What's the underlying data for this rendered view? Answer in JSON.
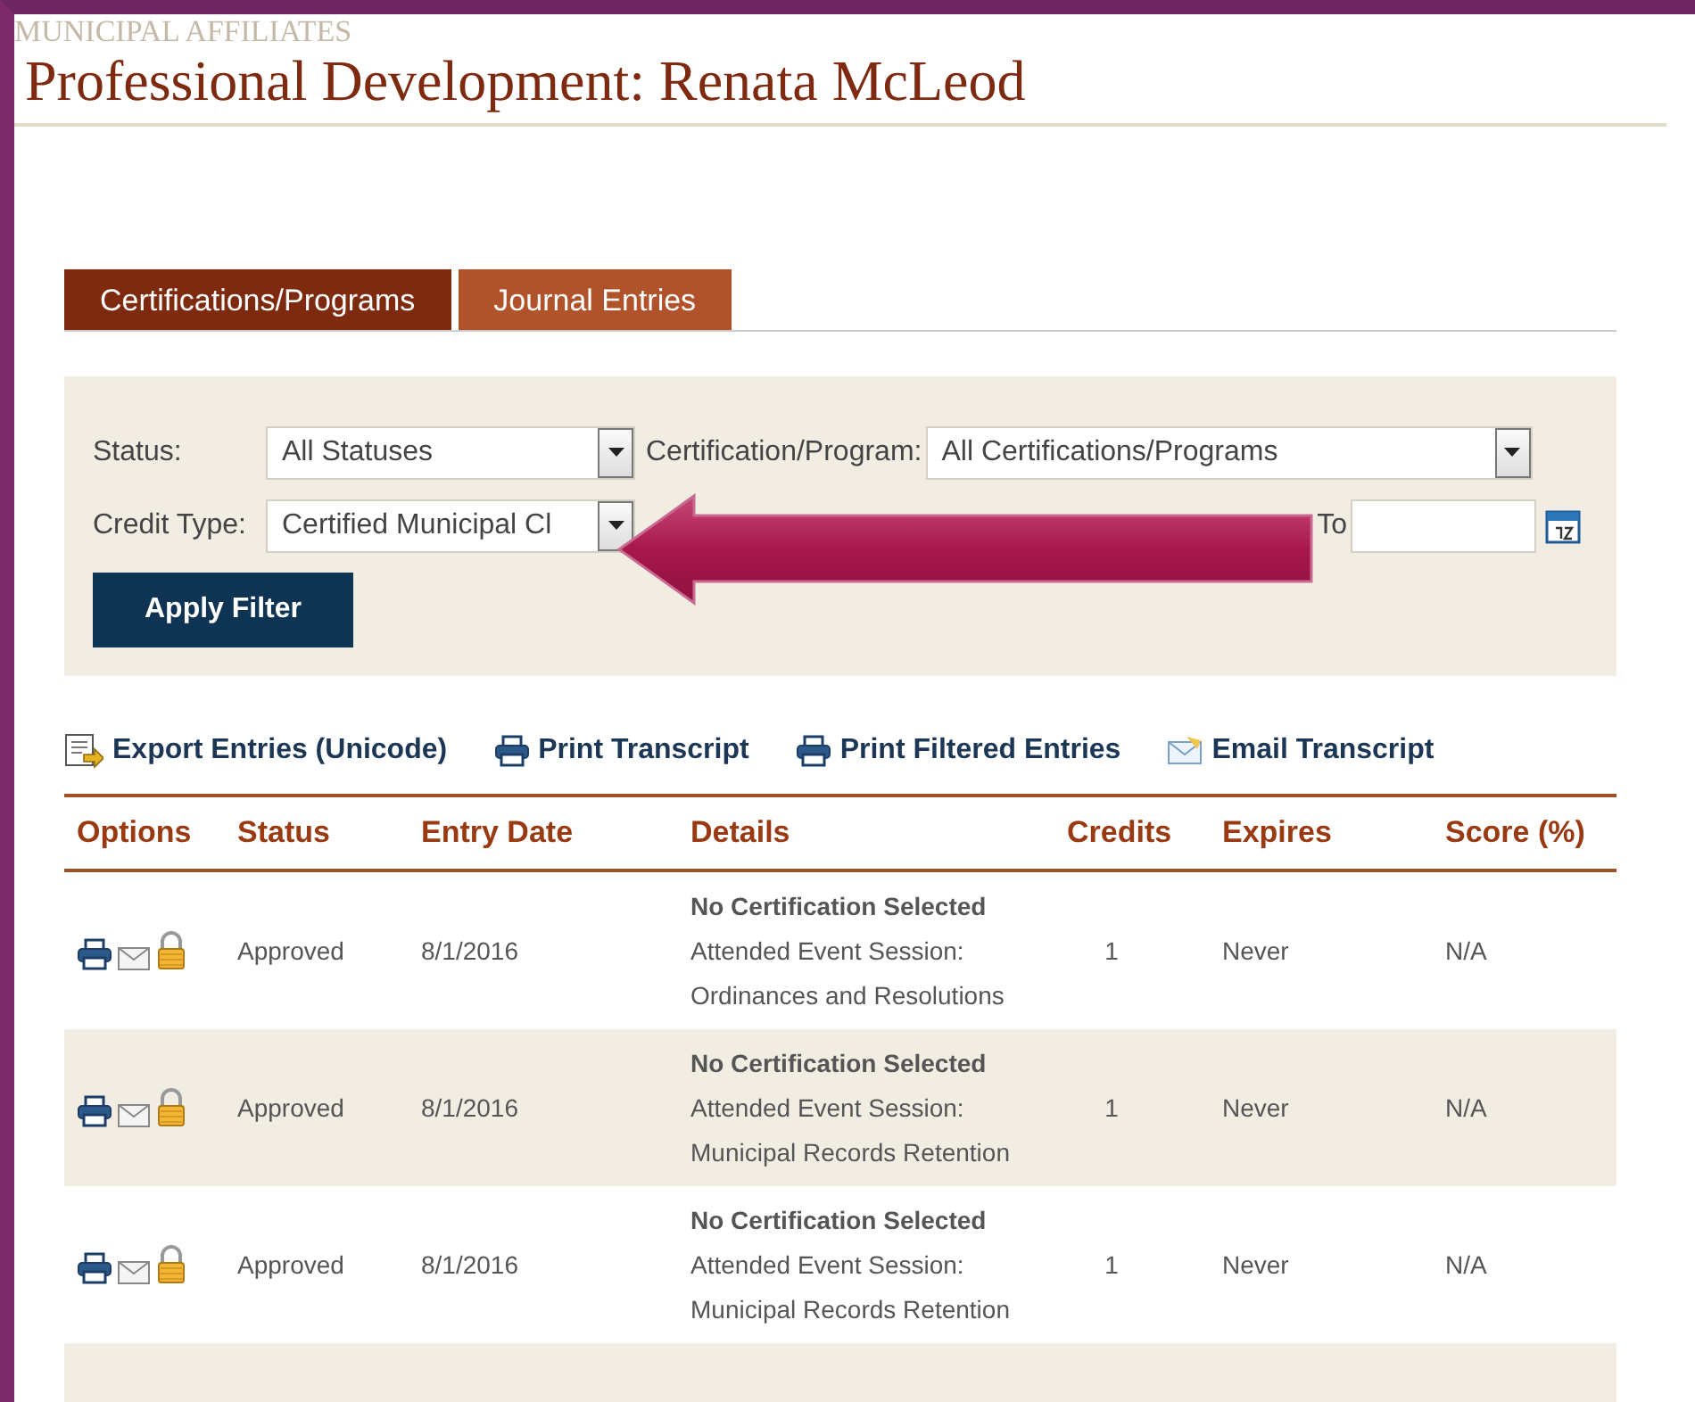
{
  "site_name": "MUNICIPAL AFFILIATES",
  "page_title": "Professional Development: Renata McLeod",
  "tabs": [
    {
      "label": "Certifications/Programs",
      "selected": true
    },
    {
      "label": "Journal Entries",
      "selected": false
    }
  ],
  "filters": {
    "status": {
      "label": "Status:",
      "value": "All Statuses"
    },
    "program": {
      "label": "Certification/Program:",
      "value": "All Certifications/Programs"
    },
    "credit_type": {
      "label": "Credit Type:",
      "value": "Certified Municipal Cl"
    },
    "date_to": {
      "label": "To"
    },
    "apply_button": "Apply Filter"
  },
  "actions": [
    {
      "kind": "export",
      "label": "Export Entries (Unicode)"
    },
    {
      "kind": "print",
      "label": "Print Transcript"
    },
    {
      "kind": "print",
      "label": "Print Filtered Entries"
    },
    {
      "kind": "email",
      "label": "Email Transcript"
    }
  ],
  "table": {
    "columns": [
      "Options",
      "Status",
      "Entry Date",
      "Details",
      "Credits",
      "Expires",
      "Score (%)"
    ],
    "rows": [
      {
        "status": "Approved",
        "entry_date": "8/1/2016",
        "certification": "No Certification Selected",
        "details": "Attended Event Session: Ordinances and Resolutions",
        "credits": "1",
        "expires": "Never",
        "score": "N/A"
      },
      {
        "status": "Approved",
        "entry_date": "8/1/2016",
        "certification": "No Certification Selected",
        "details": "Attended Event Session: Municipal Records Retention",
        "credits": "1",
        "expires": "Never",
        "score": "N/A"
      },
      {
        "status": "Approved",
        "entry_date": "8/1/2016",
        "certification": "No Certification Selected",
        "details": "Attended Event Session: Municipal Records Retention",
        "credits": "1",
        "expires": "Never",
        "score": "N/A"
      }
    ]
  }
}
